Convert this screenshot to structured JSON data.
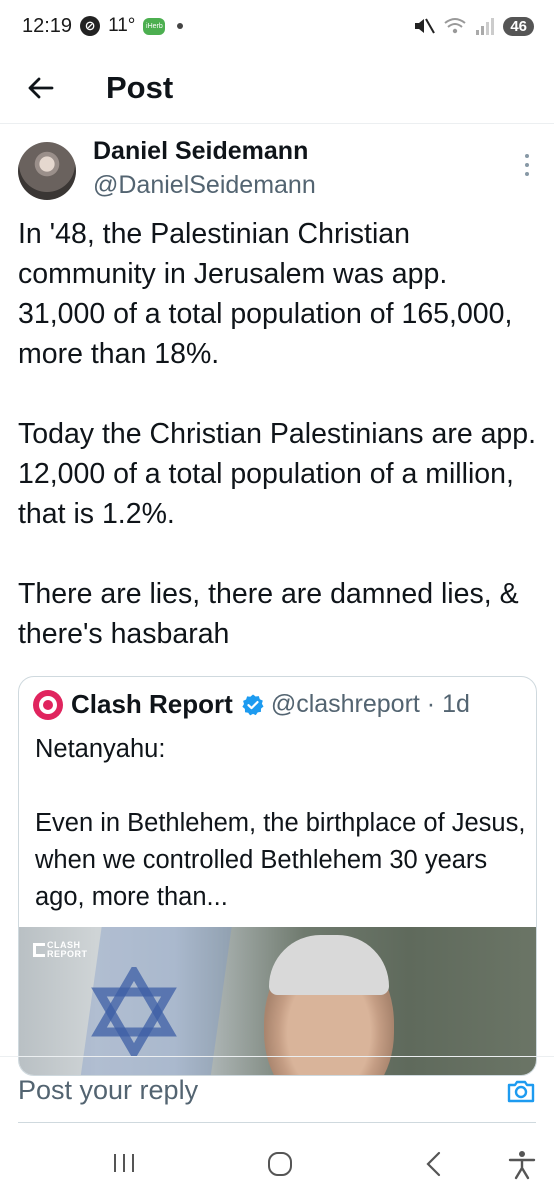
{
  "status_bar": {
    "time": "12:19",
    "temperature": "11°",
    "app_badge": "iHerb",
    "battery": "46"
  },
  "header": {
    "title": "Post"
  },
  "post": {
    "author_name": "Daniel Seidemann",
    "author_handle": "@DanielSeidemann",
    "paragraphs": [
      "In '48, the Palestinian Christian community in Jerusalem was app. 31,000 of a total population of 165,000, more than 18%.",
      "Today the Christian Palestinians are app. 12,000 of a total population of a million, that is 1.2%.",
      "There are lies, there are damned lies, & there's hasbarah"
    ]
  },
  "quote": {
    "name": "Clash Report",
    "handle_time": "@clashreport · 1d",
    "paragraphs": [
      "Netanyahu:",
      "Even in Bethlehem, the birthplace of Jesus, when we controlled Bethlehem 30 years ago, more than..."
    ],
    "watermark_line1": "CLASH",
    "watermark_line2": "REPORT"
  },
  "reply": {
    "placeholder": "Post your reply"
  },
  "colors": {
    "accent": "#1d9bf0",
    "text_primary": "#0f1419",
    "text_secondary": "#536471",
    "clash_brand": "#e0245e"
  },
  "icons": {
    "back": "arrow-left-icon",
    "more": "more-vertical-icon",
    "verified": "verified-badge-icon",
    "camera": "camera-icon",
    "recents": "recents-icon",
    "home": "home-icon",
    "nav_back": "chevron-left-icon",
    "accessibility": "accessibility-icon"
  }
}
